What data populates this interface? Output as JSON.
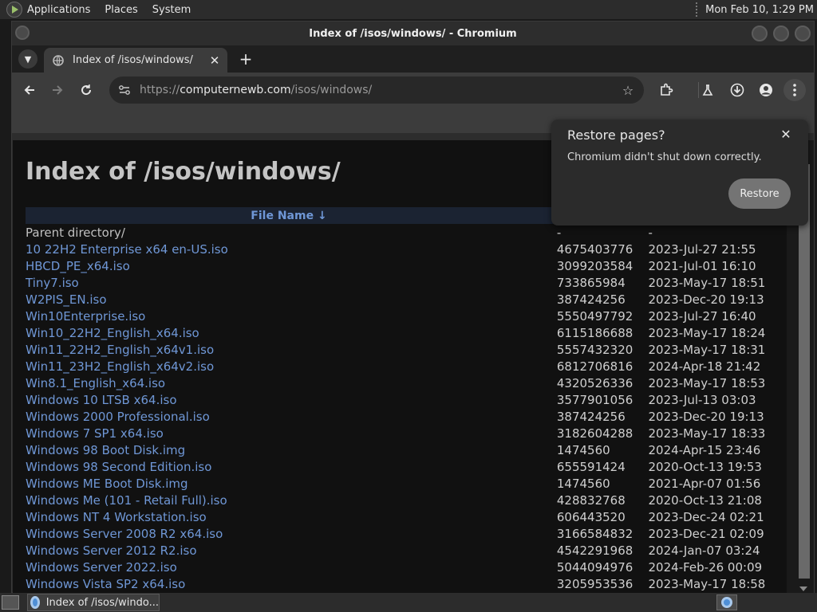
{
  "top_panel": {
    "menus": [
      "Applications",
      "Places",
      "System"
    ],
    "clock": "Mon Feb 10,  1:29 PM"
  },
  "window": {
    "title": "Index of /isos/windows/ - Chromium"
  },
  "tab": {
    "title": "Index of /isos/windows/"
  },
  "omnibox": {
    "scheme": "https://",
    "host": "computernewb.com",
    "path": "/isos/windows/"
  },
  "page": {
    "heading": "Index of /isos/windows/",
    "column_header": "File Name  ↓",
    "rows": [
      {
        "name": "Parent directory/",
        "size": "-",
        "date": "-"
      },
      {
        "name": "10 22H2 Enterprise x64 en-US.iso",
        "size": "4675403776",
        "date": "2023-Jul-27 21:55"
      },
      {
        "name": "HBCD_PE_x64.iso",
        "size": "3099203584",
        "date": "2021-Jul-01 16:10"
      },
      {
        "name": "Tiny7.iso",
        "size": "733865984",
        "date": "2023-May-17 18:51"
      },
      {
        "name": "W2PIS_EN.iso",
        "size": "387424256",
        "date": "2023-Dec-20 19:13"
      },
      {
        "name": "Win10Enterprise.iso",
        "size": "5550497792",
        "date": "2023-Jul-27 16:40"
      },
      {
        "name": "Win10_22H2_English_x64.iso",
        "size": "6115186688",
        "date": "2023-May-17 18:24"
      },
      {
        "name": "Win11_22H2_English_x64v1.iso",
        "size": "5557432320",
        "date": "2023-May-17 18:31"
      },
      {
        "name": "Win11_23H2_English_x64v2.iso",
        "size": "6812706816",
        "date": "2024-Apr-18 21:42"
      },
      {
        "name": "Win8.1_English_x64.iso",
        "size": "4320526336",
        "date": "2023-May-17 18:53"
      },
      {
        "name": "Windows 10 LTSB x64.iso",
        "size": "3577901056",
        "date": "2023-Jul-13 03:03"
      },
      {
        "name": "Windows 2000 Professional.iso",
        "size": "387424256",
        "date": "2023-Dec-20 19:13"
      },
      {
        "name": "Windows 7 SP1 x64.iso",
        "size": "3182604288",
        "date": "2023-May-17 18:33"
      },
      {
        "name": "Windows 98 Boot Disk.img",
        "size": "1474560",
        "date": "2024-Apr-15 23:46"
      },
      {
        "name": "Windows 98 Second Edition.iso",
        "size": "655591424",
        "date": "2020-Oct-13 19:53"
      },
      {
        "name": "Windows ME Boot Disk.img",
        "size": "1474560",
        "date": "2021-Apr-07 01:56"
      },
      {
        "name": "Windows Me (101 - Retail Full).iso",
        "size": "428832768",
        "date": "2020-Oct-13 21:08"
      },
      {
        "name": "Windows NT 4 Workstation.iso",
        "size": "606443520",
        "date": "2023-Dec-24 02:21"
      },
      {
        "name": "Windows Server 2008 R2 x64.iso",
        "size": "3166584832",
        "date": "2023-Dec-21 02:09"
      },
      {
        "name": "Windows Server 2012 R2.iso",
        "size": "4542291968",
        "date": "2024-Jan-07 03:24"
      },
      {
        "name": "Windows Server 2022.iso",
        "size": "5044094976",
        "date": "2024-Feb-26 00:09"
      },
      {
        "name": "Windows Vista SP2 x64.iso",
        "size": "3205953536",
        "date": "2023-May-17 18:58"
      }
    ]
  },
  "restore_dialog": {
    "title": "Restore pages?",
    "message": "Chromium didn't shut down correctly.",
    "button": "Restore"
  },
  "taskbar": {
    "item_label": "Index of /isos/windo..."
  },
  "colors": {
    "link": "#6f97d6",
    "page_bg": "#111111",
    "header_bg": "#1b2332"
  }
}
